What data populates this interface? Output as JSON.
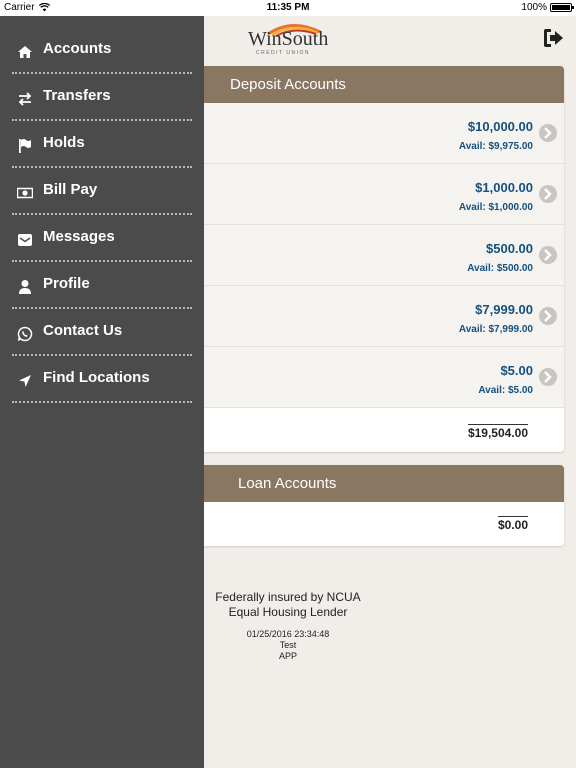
{
  "status_bar": {
    "carrier": "Carrier",
    "time": "11:35 PM",
    "battery": "100%"
  },
  "header": {
    "logo_name": "WinSouth",
    "logo_sub": "CREDIT UNION",
    "logout_icon": "logout-icon"
  },
  "menu": [
    {
      "label": "Accounts",
      "icon": "home-icon"
    },
    {
      "label": "Transfers",
      "icon": "transfer-icon"
    },
    {
      "label": "Holds",
      "icon": "flag-icon"
    },
    {
      "label": "Bill Pay",
      "icon": "money-icon"
    },
    {
      "label": "Messages",
      "icon": "envelope-icon"
    },
    {
      "label": "Profile",
      "icon": "user-icon"
    },
    {
      "label": "Contact Us",
      "icon": "whatsapp-icon"
    },
    {
      "label": "Find Locations",
      "icon": "location-arrow-icon"
    }
  ],
  "deposit": {
    "title": "Deposit Accounts",
    "accounts": [
      {
        "amount": "$10,000.00",
        "avail": "Avail: $9,975.00"
      },
      {
        "amount": "$1,000.00",
        "avail": "Avail: $1,000.00"
      },
      {
        "amount": "$500.00",
        "avail": "Avail: $500.00"
      },
      {
        "amount": "$7,999.00",
        "avail": "Avail: $7,999.00"
      },
      {
        "amount": "$5.00",
        "avail": "Avail: $5.00"
      }
    ],
    "total": "$19,504.00"
  },
  "loan": {
    "title": "Loan Accounts",
    "total": "$0.00"
  },
  "footer": {
    "line1": "Federally insured by NCUA",
    "line2": "Equal Housing Lender",
    "timestamp": "01/25/2016 23:34:48",
    "env": "Test",
    "app": "APP"
  },
  "colors": {
    "drawer": "#4b4b4b",
    "panel_header": "#8a7761",
    "amount": "#15507e",
    "background": "#f1ede9"
  }
}
